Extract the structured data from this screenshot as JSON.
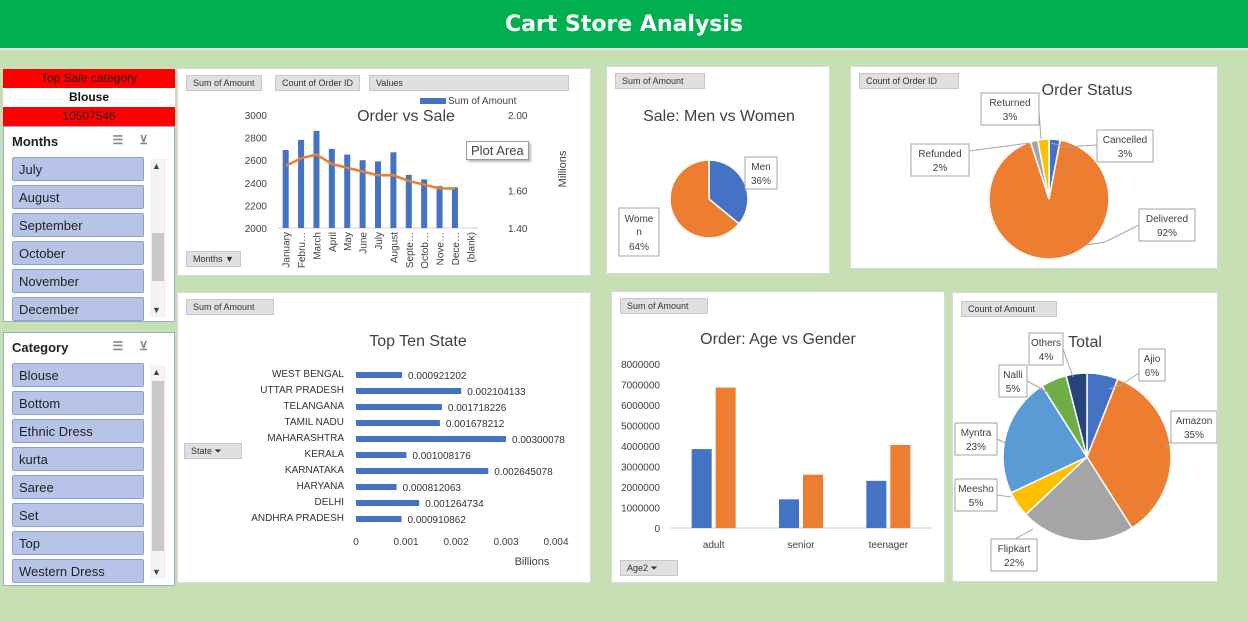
{
  "header": {
    "title": "Cart Store Analysis"
  },
  "top_sale": {
    "label": "Top Sale category",
    "category": "Blouse",
    "value": "10507546"
  },
  "months_slicer": {
    "title": "Months",
    "items": [
      "July",
      "August",
      "September",
      "October",
      "November",
      "December"
    ]
  },
  "category_slicer": {
    "title": "Category",
    "items": [
      "Blouse",
      "Bottom",
      "Ethnic Dress",
      "kurta",
      "Saree",
      "Set",
      "Top",
      "Western Dress"
    ]
  },
  "icons": {
    "multi_select": "multi-select-icon",
    "clear_filter": "clear-filter-icon",
    "scroll_up": "scroll-up-icon",
    "scroll_down": "scroll-down-icon",
    "filter": "filter-icon",
    "dropdown": "dropdown-icon"
  },
  "colors": {
    "header": "#00b050",
    "background": "#c6e0b4",
    "blue": "#4472c4",
    "orange": "#ed7d31",
    "gray": "#a5a5a5",
    "yellow": "#ffc000",
    "lightblue": "#5b9bd5",
    "green": "#70ad47",
    "navy": "#264478",
    "red": "#ff0000"
  },
  "order_vs_sale": {
    "field_buttons": [
      "Sum of Amount",
      "Count of Order ID",
      "Values"
    ],
    "axis_button": "Months",
    "tooltip": "Plot Area",
    "chart_data": {
      "type": "bar",
      "title": "Order vs Sale",
      "categories": [
        "January",
        "Febru…",
        "March",
        "April",
        "May",
        "June",
        "July",
        "August",
        "Septe…",
        "Octob…",
        "Nove…",
        "Dece…",
        "(blank)"
      ],
      "series": [
        {
          "name": "Sum of Amount",
          "values": [
            2690,
            2780,
            2860,
            2700,
            2650,
            2600,
            2590,
            2670,
            2470,
            2430,
            2370,
            2360,
            null
          ]
        },
        {
          "name": "",
          "values": [
            1.73,
            1.77,
            1.79,
            1.74,
            1.72,
            1.7,
            1.68,
            1.68,
            1.65,
            1.63,
            1.61,
            1.61,
            null
          ]
        }
      ],
      "yticks": [
        "3000",
        "2800",
        "2600",
        "2400",
        "2200",
        "2000"
      ],
      "y2ticks": [
        "2.00",
        "1.80",
        "1.60",
        "1.40"
      ],
      "y2label": "Millions",
      "ylim": [
        2000,
        3000
      ],
      "y2lim": [
        1.4,
        2.0
      ]
    }
  },
  "men_women": {
    "field_button": "Sum of Amount",
    "chart_data": {
      "type": "pie",
      "title": "Sale: Men vs Women",
      "labels": [
        "Men",
        "Women"
      ],
      "label_pcts": [
        "36%",
        "64%"
      ],
      "values": [
        36,
        64
      ]
    }
  },
  "order_status": {
    "field_button": "Count of Order ID",
    "chart_data": {
      "type": "pie",
      "title": "Order Status",
      "labels": [
        "Cancelled",
        "Delivered",
        "Refunded",
        "Returned"
      ],
      "label_pcts": [
        "3%",
        "92%",
        "2%",
        "3%"
      ],
      "values": [
        3,
        92,
        2,
        3
      ]
    }
  },
  "top_state": {
    "field_button": "Sum of Amount",
    "axis_button": "State",
    "chart_data": {
      "type": "bar",
      "title": "Top Ten State",
      "categories": [
        "WEST BENGAL",
        "UTTAR PRADESH",
        "TELANGANA",
        "TAMIL NADU",
        "MAHARASHTRA",
        "KERALA",
        "KARNATAKA",
        "HARYANA",
        "DELHI",
        "ANDHRA PRADESH"
      ],
      "values": [
        0.000921202,
        0.002104133,
        0.001718226,
        0.001678212,
        0.00300078,
        0.001008176,
        0.002645078,
        0.000812063,
        0.001264734,
        0.000910862
      ],
      "value_labels": [
        "0.000921202",
        "0.002104133",
        "0.001718226",
        "0.001678212",
        "0.00300078",
        "0.001008176",
        "0.002645078",
        "0.000812063",
        "0.001264734",
        "0.000910862"
      ],
      "xticks": [
        "0",
        "0.001",
        "0.002",
        "0.003",
        "0.004"
      ],
      "xlabel": "Billions",
      "xlim": [
        0,
        0.004
      ]
    }
  },
  "age_gender": {
    "field_button": "Sum of Amount",
    "axis_button": "Age2",
    "chart_data": {
      "type": "bar",
      "title": "Order: Age vs  Gender",
      "categories": [
        "adult",
        "senior",
        "teenager"
      ],
      "series": [
        {
          "name": "",
          "values": [
            3850000,
            1400000,
            2300000
          ]
        },
        {
          "name": "",
          "values": [
            6850000,
            2600000,
            4050000
          ]
        }
      ],
      "yticks": [
        "8000000",
        "7000000",
        "6000000",
        "5000000",
        "4000000",
        "3000000",
        "2000000",
        "1000000",
        "0"
      ],
      "ylim": [
        0,
        8000000
      ]
    }
  },
  "platform_total": {
    "field_button": "Count of Amount",
    "chart_data": {
      "type": "pie",
      "title": "Total",
      "labels": [
        "Ajio",
        "Amazon",
        "Flipkart",
        "Meesho",
        "Myntra",
        "Nalli",
        "Others"
      ],
      "label_pcts": [
        "6%",
        "35%",
        "22%",
        "5%",
        "23%",
        "5%",
        "4%"
      ],
      "values": [
        6,
        35,
        22,
        5,
        23,
        5,
        4
      ]
    }
  }
}
